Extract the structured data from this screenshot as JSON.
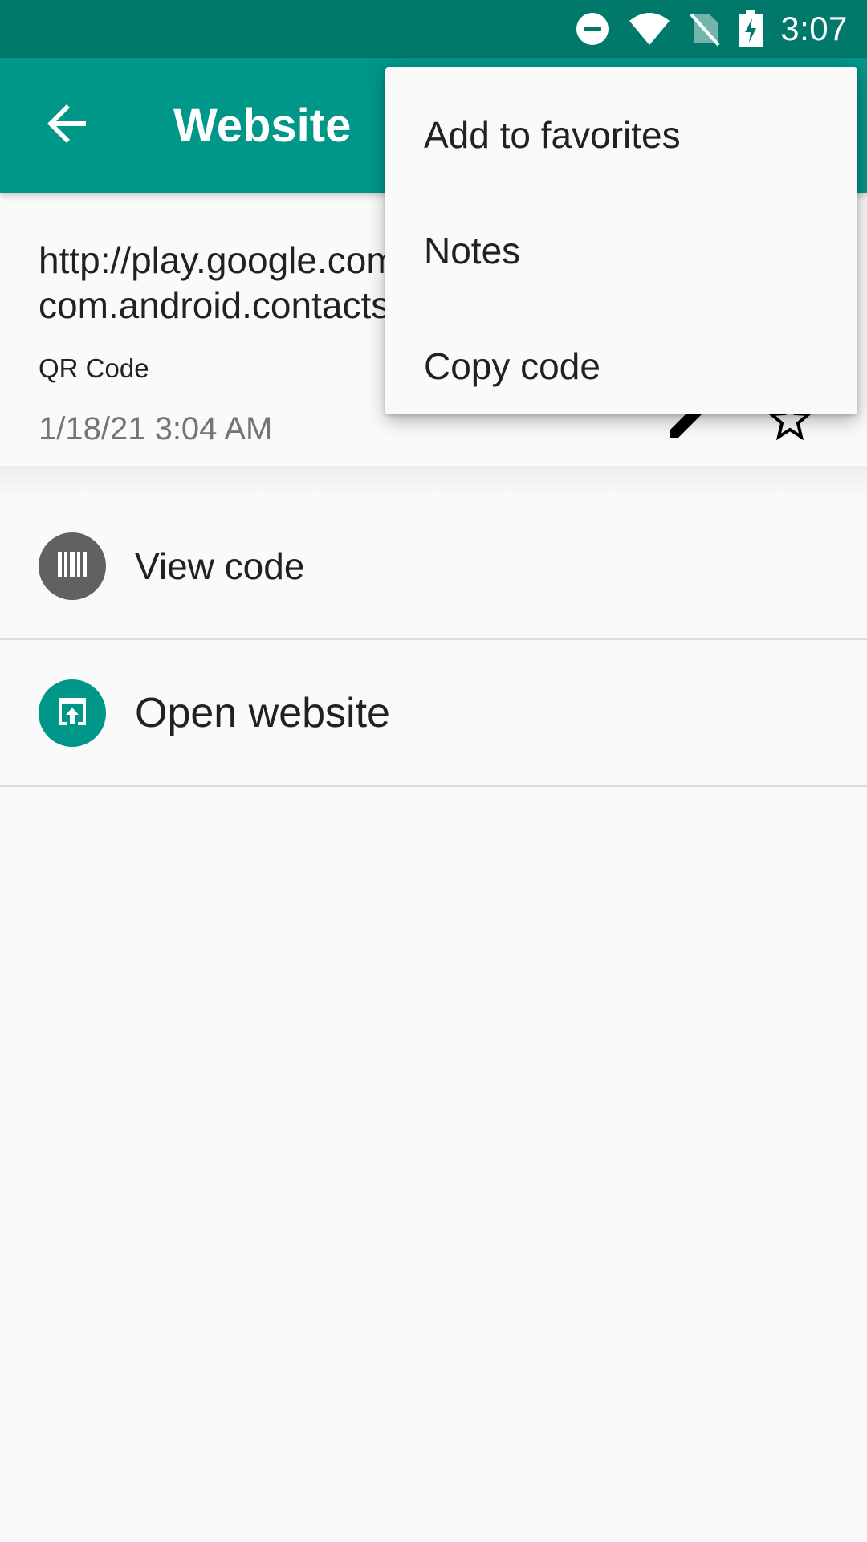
{
  "status_bar": {
    "time": "3:07",
    "icons": [
      "do-not-disturb-icon",
      "wifi-icon",
      "no-sim-icon",
      "battery-charging-icon"
    ]
  },
  "app_bar": {
    "title": "Website",
    "back_icon": "arrow-back-icon"
  },
  "code": {
    "text": "http://play.google.com/store/apps/details?id=\ncom.android.contacts",
    "format": "QR Code",
    "date": "1/18/21 3:04 AM",
    "edit_icon": "pencil-icon",
    "favorite_icon": "star-outline-icon"
  },
  "actions": [
    {
      "label": "View code",
      "icon": "barcode-icon",
      "color": "#616161"
    },
    {
      "label": "Open website",
      "icon": "open-in-browser-icon",
      "color": "#009688"
    }
  ],
  "menu": {
    "items": [
      "Add to favorites",
      "Notes",
      "Copy code"
    ]
  },
  "colors": {
    "status_bar": "#00796b",
    "app_bar": "#009688",
    "background": "#fafafa"
  }
}
